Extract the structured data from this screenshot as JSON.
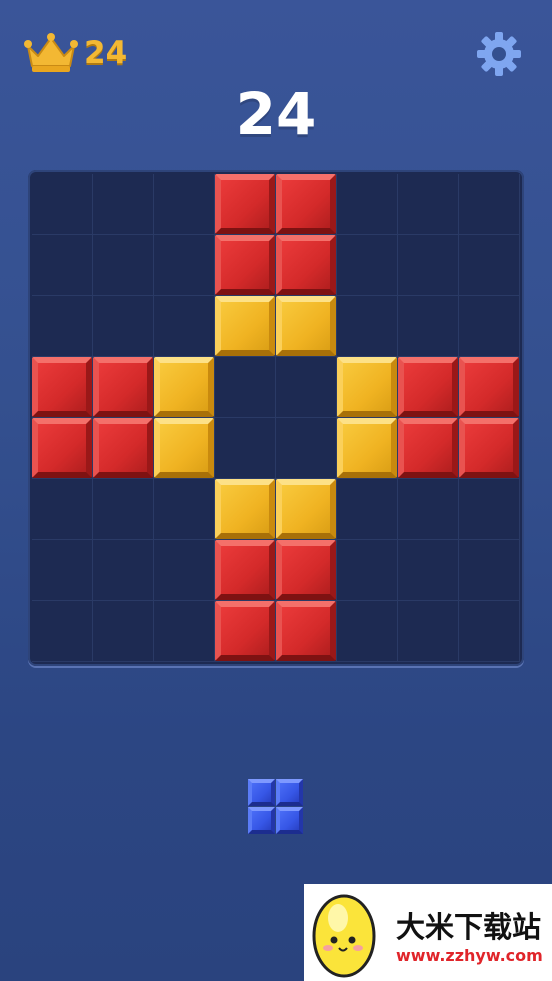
{
  "header": {
    "best_score": "24",
    "current_score": "24",
    "best_icon": "crown-icon",
    "settings_icon": "gear-icon"
  },
  "board": {
    "rows": 8,
    "cols": 8,
    "blocks": [
      {
        "row": 0,
        "col": 3,
        "color": "red"
      },
      {
        "row": 0,
        "col": 4,
        "color": "red"
      },
      {
        "row": 1,
        "col": 3,
        "color": "red"
      },
      {
        "row": 1,
        "col": 4,
        "color": "red"
      },
      {
        "row": 2,
        "col": 3,
        "color": "yellow"
      },
      {
        "row": 2,
        "col": 4,
        "color": "yellow"
      },
      {
        "row": 3,
        "col": 0,
        "color": "red"
      },
      {
        "row": 3,
        "col": 1,
        "color": "red"
      },
      {
        "row": 3,
        "col": 2,
        "color": "yellow"
      },
      {
        "row": 3,
        "col": 5,
        "color": "yellow"
      },
      {
        "row": 3,
        "col": 6,
        "color": "red"
      },
      {
        "row": 3,
        "col": 7,
        "color": "red"
      },
      {
        "row": 4,
        "col": 0,
        "color": "red"
      },
      {
        "row": 4,
        "col": 1,
        "color": "red"
      },
      {
        "row": 4,
        "col": 2,
        "color": "yellow"
      },
      {
        "row": 4,
        "col": 5,
        "color": "yellow"
      },
      {
        "row": 4,
        "col": 6,
        "color": "red"
      },
      {
        "row": 4,
        "col": 7,
        "color": "red"
      },
      {
        "row": 5,
        "col": 3,
        "color": "yellow"
      },
      {
        "row": 5,
        "col": 4,
        "color": "yellow"
      },
      {
        "row": 6,
        "col": 3,
        "color": "red"
      },
      {
        "row": 6,
        "col": 4,
        "color": "red"
      },
      {
        "row": 7,
        "col": 3,
        "color": "red"
      },
      {
        "row": 7,
        "col": 4,
        "color": "red"
      }
    ]
  },
  "tray": {
    "piece_shape": "2x2 square",
    "piece_color": "#3f60ee"
  },
  "colors": {
    "background": "#34508f",
    "board": "#1d2a52",
    "red": "#d42a2a",
    "yellow": "#f0b322",
    "blue": "#3f60ee",
    "best_score": "#f3b833"
  },
  "watermark": {
    "title": "大米下载站",
    "url": "www.zzhyw.com"
  }
}
